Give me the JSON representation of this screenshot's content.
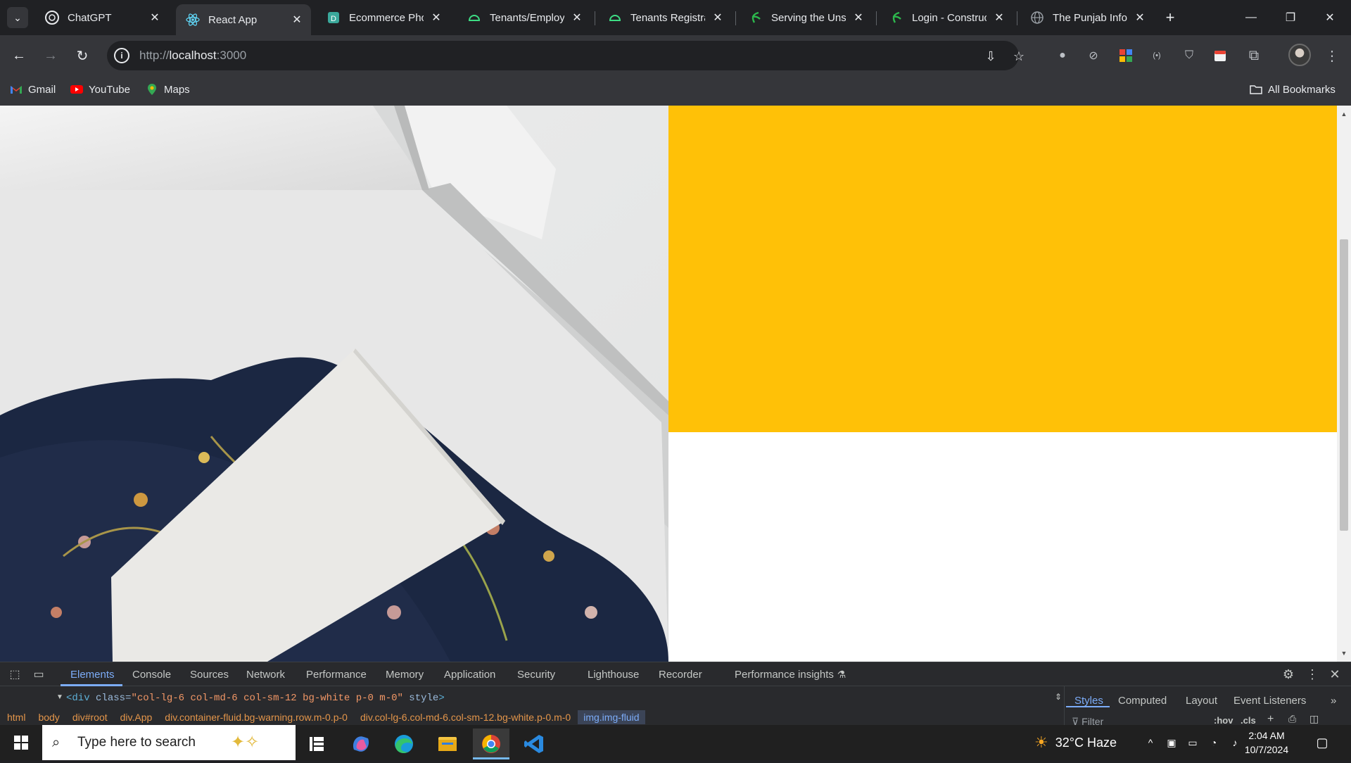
{
  "browser": {
    "tabs": [
      {
        "title": "ChatGPT",
        "icon": "chatgpt-icon",
        "active": false
      },
      {
        "title": "React App",
        "icon": "react-icon",
        "active": true
      },
      {
        "title": "Ecommerce Phot",
        "icon": "document-icon",
        "active": false
      },
      {
        "title": "Tenants/Employe",
        "icon": "android-icon",
        "active": false
      },
      {
        "title": "Tenants Registrat",
        "icon": "android-icon",
        "active": false
      },
      {
        "title": "Serving the Unse",
        "icon": "leaf-icon",
        "active": false
      },
      {
        "title": "Login - Construc",
        "icon": "leaf-icon",
        "active": false
      },
      {
        "title": "The Punjab Infor",
        "icon": "globe-icon",
        "active": false
      }
    ],
    "url_scheme": "http://",
    "url_host": "localhost",
    "url_port": ":3000",
    "bookmarks": [
      {
        "label": "Gmail",
        "icon": "gmail-icon"
      },
      {
        "label": "YouTube",
        "icon": "youtube-icon"
      },
      {
        "label": "Maps",
        "icon": "maps-icon"
      }
    ],
    "all_bookmarks": "All Bookmarks"
  },
  "page": {
    "panel_color": "#ffc107",
    "image_alt": "Gift box with floral fabric and blank card"
  },
  "devtools": {
    "tabs": [
      "Elements",
      "Console",
      "Sources",
      "Network",
      "Performance",
      "Memory",
      "Application",
      "Security",
      "Lighthouse",
      "Recorder",
      "Performance insights"
    ],
    "dom_tag_open": "<div ",
    "dom_attr1_name": "class=",
    "dom_attr1_val": "\"col-lg-6 col-md-6 col-sm-12 bg-white p-0 m-0\"",
    "dom_attr2_name": " style",
    "dom_tag_close": ">",
    "breadcrumbs": [
      "html",
      "body",
      "div#root",
      "div.App",
      "div.container-fluid.bg-warning.row.m-0.p-0",
      "div.col-lg-6.col-md-6.col-sm-12.bg-white.p-0.m-0",
      "img.img-fluid"
    ],
    "styles_tabs": [
      "Styles",
      "Computed",
      "Layout",
      "Event Listeners"
    ],
    "filter_placeholder": "Filter",
    "hov": ":hov",
    "cls": ".cls"
  },
  "taskbar": {
    "search_placeholder": "Type here to search",
    "weather": "32°C  Haze",
    "time": "2:04 AM",
    "date": "10/7/2024"
  }
}
